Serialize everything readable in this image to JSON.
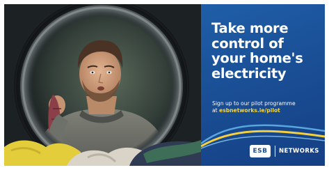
{
  "ad": {
    "headline": [
      "Take more",
      "control of",
      "your home's",
      "electricity"
    ],
    "cta": {
      "line1": "Sign up to our pilot programme",
      "prefix": "at ",
      "url": "esbnetworks.ie/pilot"
    },
    "logo": {
      "mark": "ESB",
      "word": "NETWORKS"
    },
    "colors": {
      "panel": "#1a4f96",
      "url": "#f6d63c",
      "swoosh_yellow": "#f4d03f",
      "swoosh_blue": "#5fb0e8"
    },
    "photo": {
      "subject": "man-looking-into-washing-machine-drum",
      "icons": [
        "washing-machine-drum-icon",
        "laundry-pile-icon"
      ]
    }
  }
}
